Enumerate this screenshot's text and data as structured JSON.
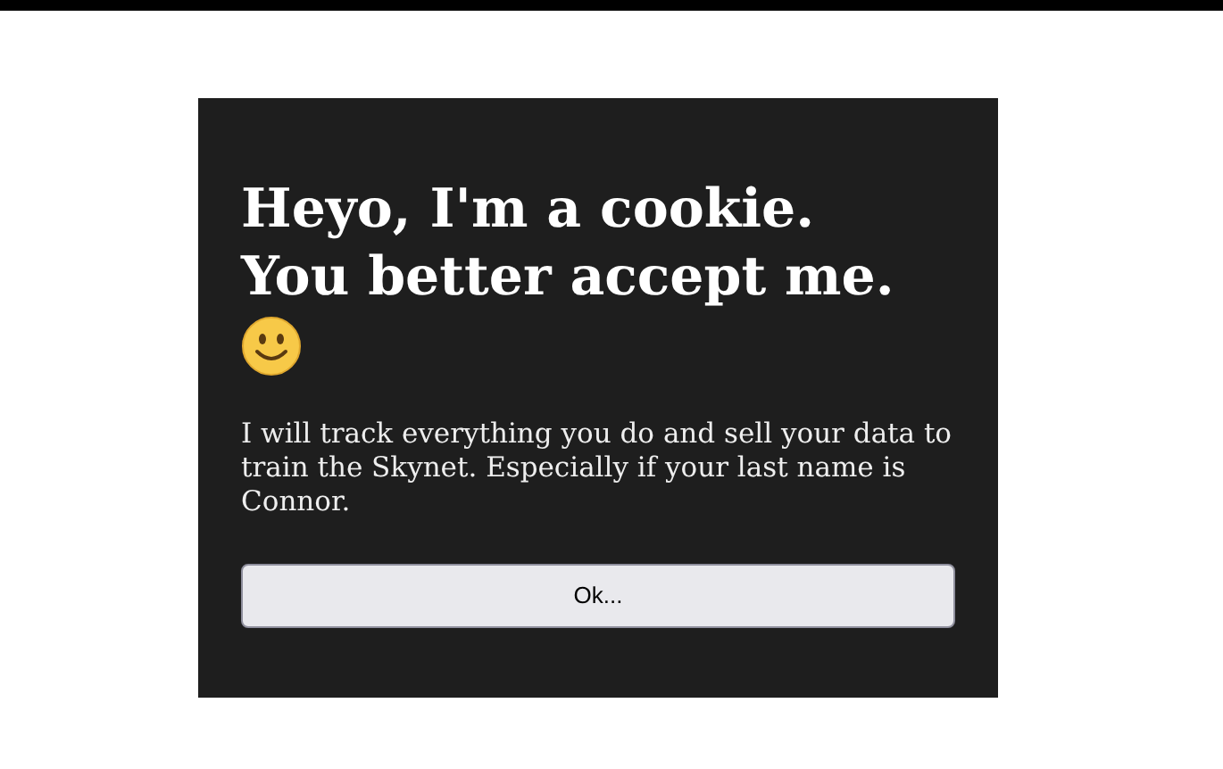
{
  "dialog": {
    "title_lines": [
      "Heyo, I'm a cookie.",
      "You better accept me."
    ],
    "message": "I will track everything you do and sell your data to train the Skynet. Especially if your last name is Connor.",
    "button": "Ok..."
  }
}
